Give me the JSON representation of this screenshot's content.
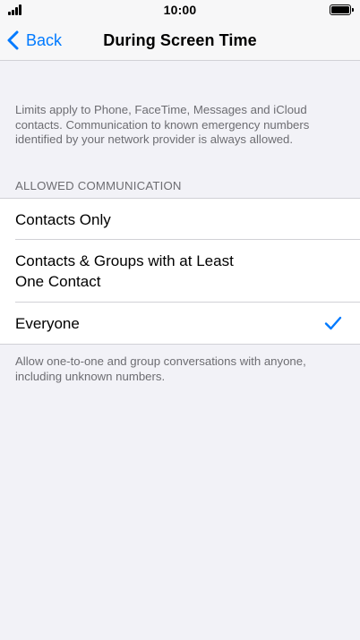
{
  "status_bar": {
    "time": "10:00",
    "signal_icon": "cellular-signal-icon",
    "battery_icon": "battery-full-icon"
  },
  "nav": {
    "back_label": "Back",
    "back_icon": "chevron-left-icon",
    "title": "During Screen Time"
  },
  "intro": "Limits apply to Phone, FaceTime, Messages and iCloud contacts. Communication to known emergency numbers identified by your network provider is always allowed.",
  "section_header": "ALLOWED COMMUNICATION",
  "options": [
    {
      "label": "Contacts Only",
      "selected": false
    },
    {
      "label": "Contacts & Groups with at Least One Contact",
      "selected": false
    },
    {
      "label": "Everyone",
      "selected": true
    }
  ],
  "footer": "Allow one-to-one and group conversations with anyone, including unknown numbers.",
  "colors": {
    "accent": "#007aff",
    "secondary_text": "#6d6d72",
    "background": "#f2f2f7"
  }
}
